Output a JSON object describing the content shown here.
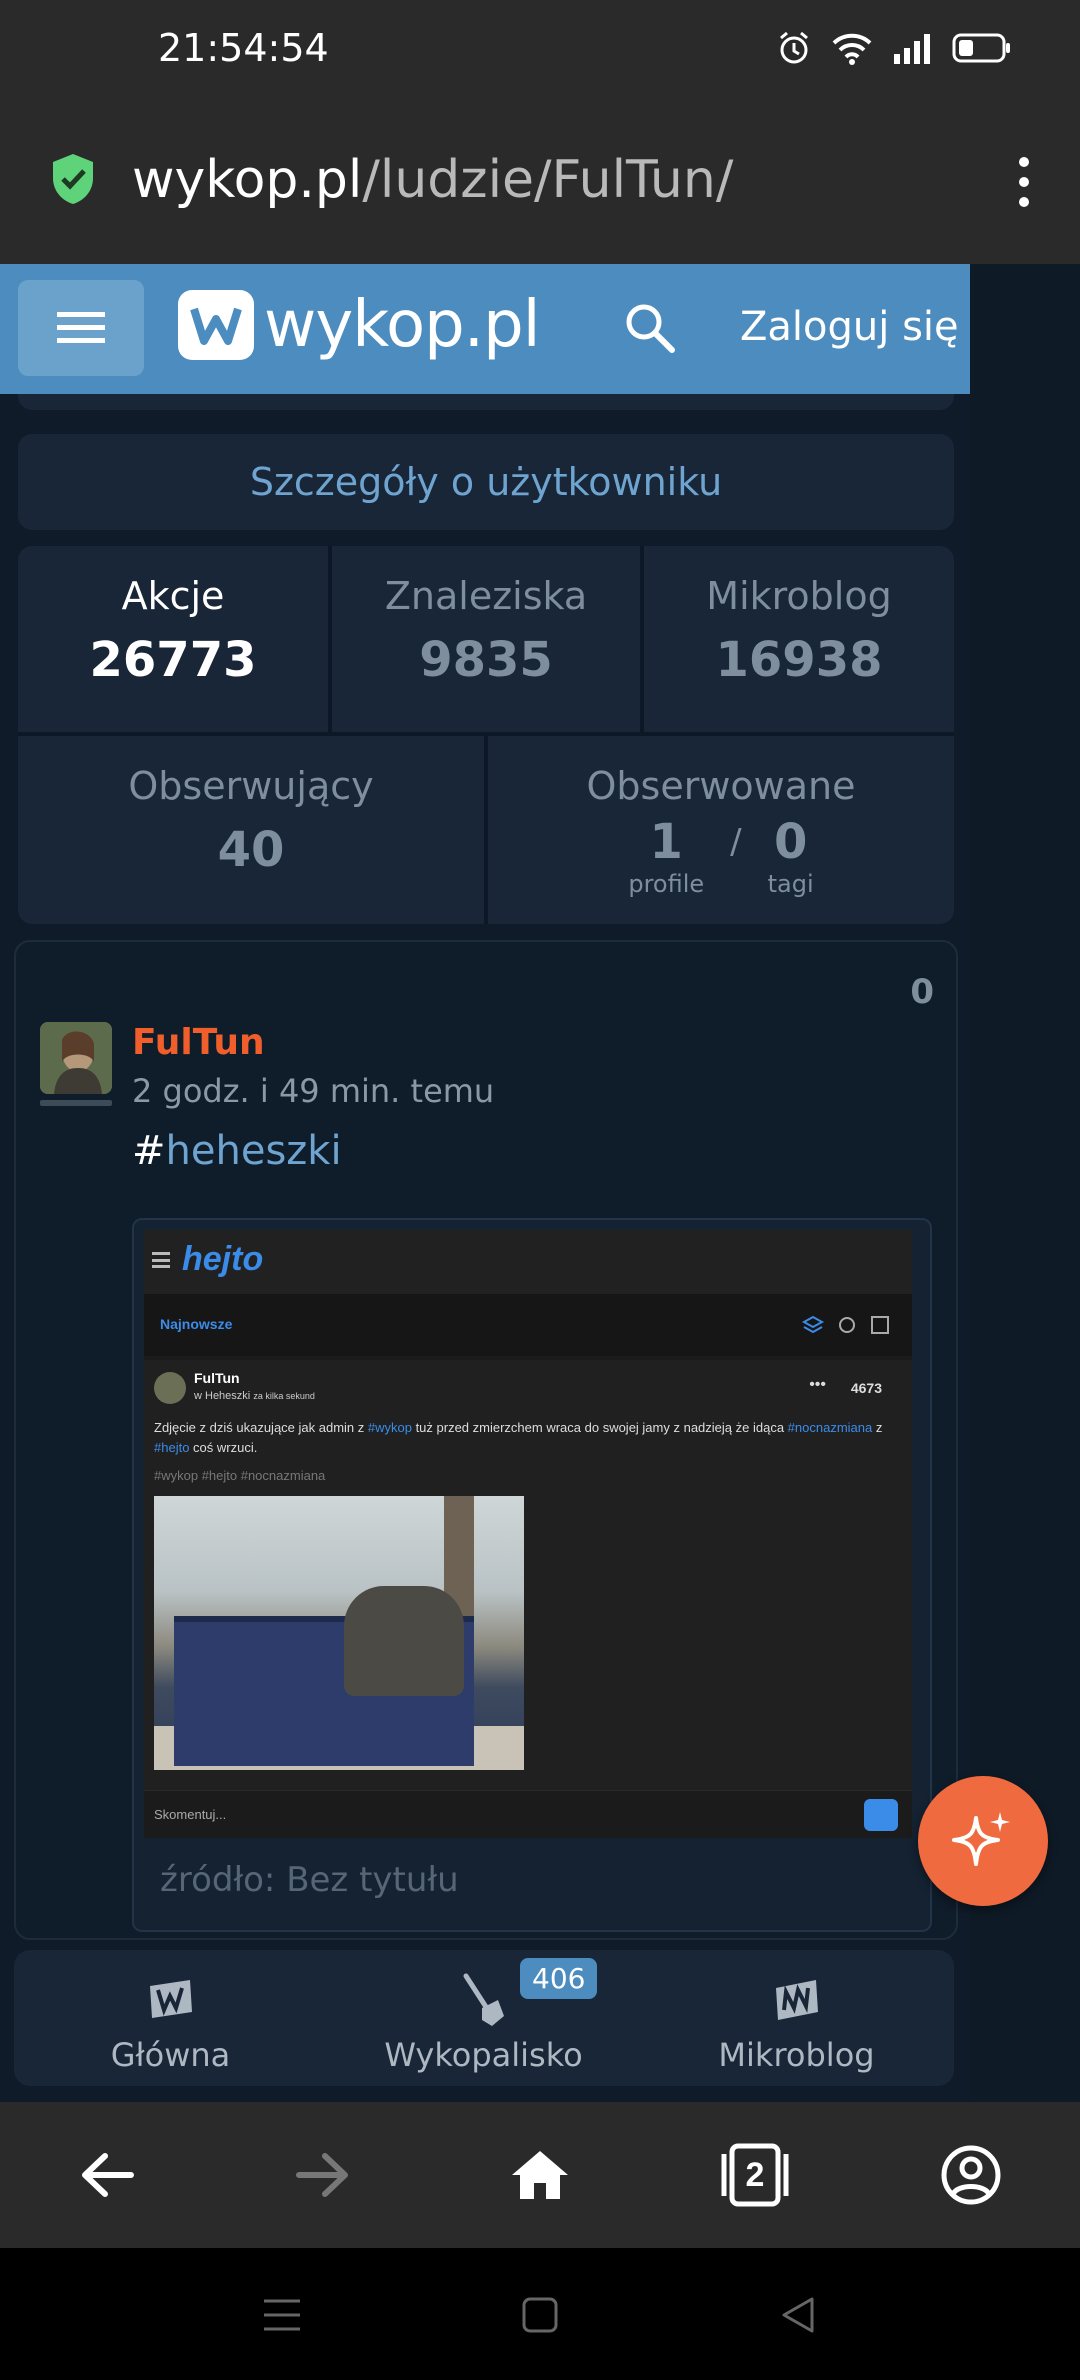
{
  "status_bar": {
    "time": "21:54:54"
  },
  "browser": {
    "url_host": "wykop.pl",
    "url_path": "/ludzie/FulTun/",
    "tabs_count": "2"
  },
  "header": {
    "logo_text": "wykop.pl",
    "login_label": "Zaloguj się"
  },
  "details_link": "Szczegóły o użytkowniku",
  "stats": {
    "actions": {
      "label": "Akcje",
      "value": "26773"
    },
    "links": {
      "label": "Znaleziska",
      "value": "9835"
    },
    "microblog": {
      "label": "Mikroblog",
      "value": "16938"
    },
    "followers": {
      "label": "Obserwujący",
      "value": "40"
    },
    "following": {
      "label": "Obserwowane",
      "profiles_value": "1",
      "profiles_label": "profile",
      "separator": "/",
      "tags_value": "0",
      "tags_label": "tagi"
    }
  },
  "post": {
    "votes": "0",
    "author": "FulTun",
    "time": "2 godz. i 49 min. temu",
    "tag_hash": "#",
    "tag_name": "heheszki",
    "source": "źródło: Bez tytułu",
    "embedded_screenshot": {
      "brand": "hejto",
      "tab": "Najnowsze",
      "author": "FulTun",
      "community": "w Heheszki",
      "age": "za kilka sekund",
      "score": "4673",
      "text_1": "Zdjęcie z dziś ukazujące jak admin z ",
      "link_1": "#wykop",
      "text_2": " tuż przed zmierzchem wraca do swojej jamy z nadzieją że idąca ",
      "link_2": "#nocnazmiana",
      "text_3": " z ",
      "link_3": "#hejto",
      "text_4": " coś wrzuci.",
      "tags": "#wykop  #hejto  #nocnazmiana",
      "comment_placeholder": "Skomentuj..."
    }
  },
  "bottom_nav": {
    "home_label": "Główna",
    "dig_label": "Wykopalisko",
    "dig_badge": "406",
    "microblog_label": "Mikroblog"
  },
  "colors": {
    "brand_blue": "#4d8cbf",
    "author_orange": "#f05f2b",
    "fab_orange": "#f06a3f",
    "link_blue": "#6ea4cf"
  }
}
